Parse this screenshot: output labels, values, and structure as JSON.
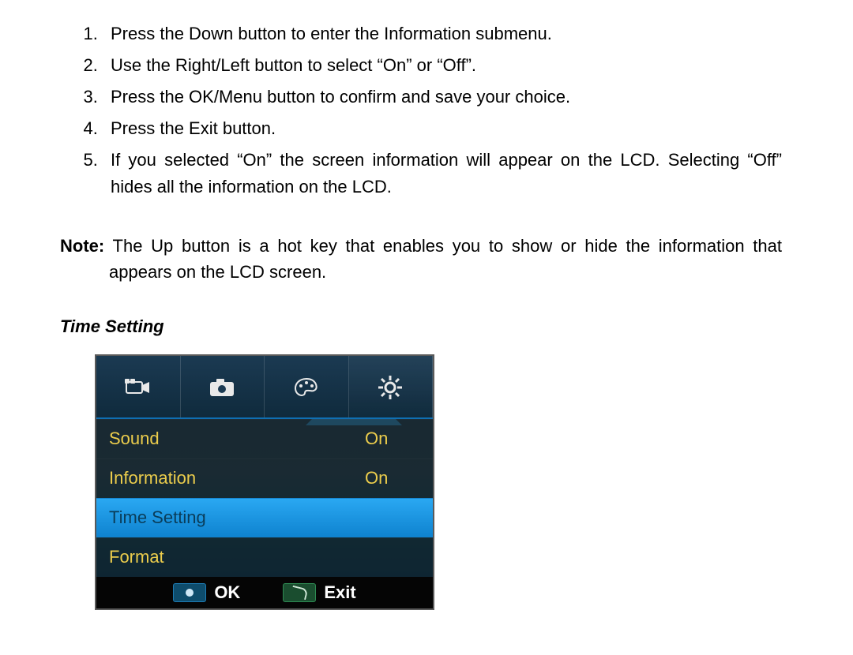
{
  "instructions": {
    "items": [
      "Press the Down button to enter the Information submenu.",
      "Use the Right/Left button to select “On” or “Off”.",
      "Press the OK/Menu button to confirm and save your choice.",
      "Press the Exit button.",
      "If you selected “On” the screen information will appear on the LCD. Selecting “Off” hides all the information on the LCD."
    ]
  },
  "note": {
    "label": "Note:",
    "text": "The Up button is a hot key that enables you to show or hide the information that appears on the LCD screen."
  },
  "section_heading": "Time Setting",
  "lcd": {
    "tabs": [
      {
        "icon": "video-icon",
        "active": false
      },
      {
        "icon": "camera-icon",
        "active": false
      },
      {
        "icon": "palette-icon",
        "active": false
      },
      {
        "icon": "gear-icon",
        "active": true
      }
    ],
    "rows": [
      {
        "label": "Sound",
        "value": "On",
        "selected": false
      },
      {
        "label": "Information",
        "value": "On",
        "selected": false
      },
      {
        "label": "Time Setting",
        "value": "",
        "selected": true
      },
      {
        "label": "Format",
        "value": "",
        "selected": false
      }
    ],
    "footer": {
      "ok_label": "OK",
      "exit_label": "Exit"
    }
  }
}
